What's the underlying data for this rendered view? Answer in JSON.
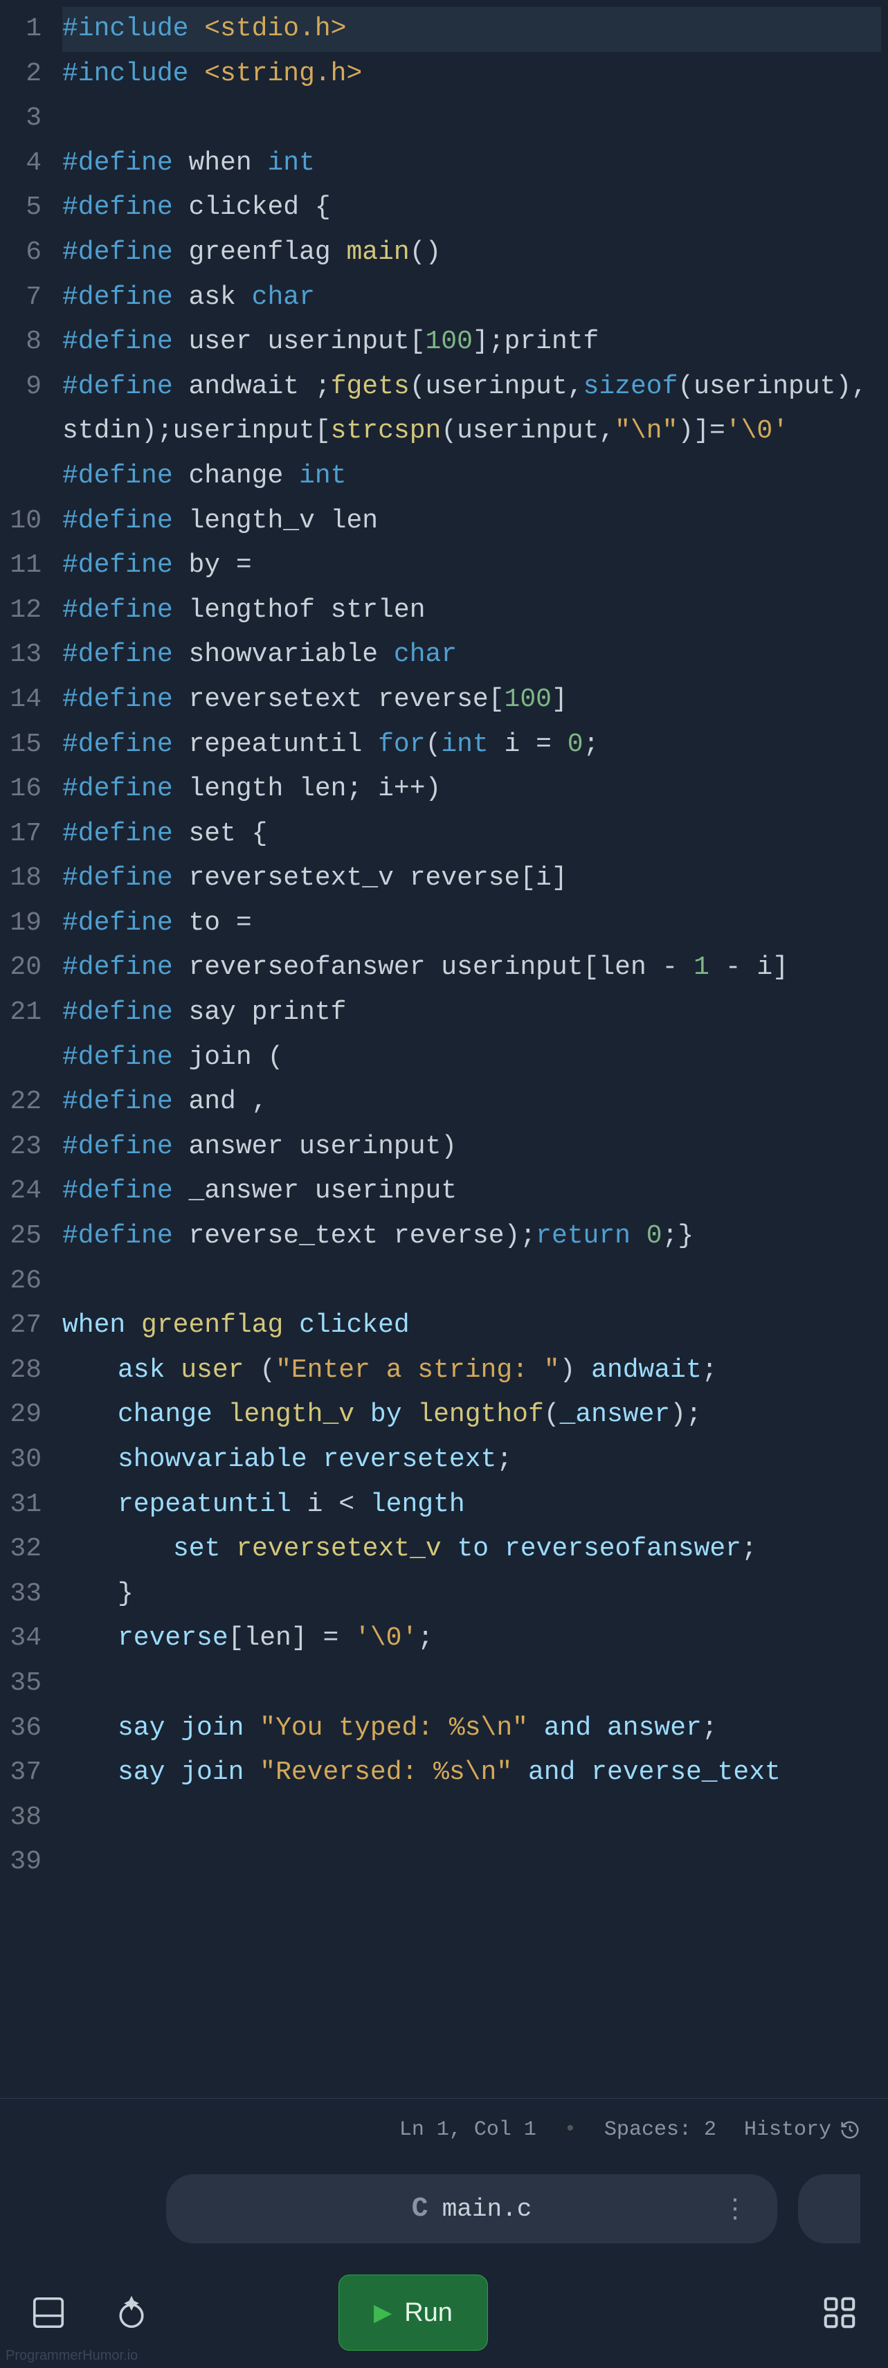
{
  "code": {
    "lines": [
      {
        "n": 1,
        "hl": true,
        "tokens": [
          {
            "c": "tok-pp",
            "t": "#include"
          },
          {
            "c": "tok-plain",
            "t": " "
          },
          {
            "c": "tok-str",
            "t": "<stdio.h>"
          }
        ]
      },
      {
        "n": 2,
        "tokens": [
          {
            "c": "tok-pp",
            "t": "#include"
          },
          {
            "c": "tok-plain",
            "t": " "
          },
          {
            "c": "tok-str",
            "t": "<string.h>"
          }
        ]
      },
      {
        "n": 3,
        "tokens": []
      },
      {
        "n": 4,
        "tokens": [
          {
            "c": "tok-pp",
            "t": "#define"
          },
          {
            "c": "tok-plain",
            "t": " when "
          },
          {
            "c": "tok-pp",
            "t": "int"
          }
        ]
      },
      {
        "n": 5,
        "tokens": [
          {
            "c": "tok-pp",
            "t": "#define"
          },
          {
            "c": "tok-plain",
            "t": " clicked {"
          }
        ]
      },
      {
        "n": 6,
        "tokens": [
          {
            "c": "tok-pp",
            "t": "#define"
          },
          {
            "c": "tok-plain",
            "t": " greenflag "
          },
          {
            "c": "tok-fn",
            "t": "main"
          },
          {
            "c": "tok-plain",
            "t": "()"
          }
        ]
      },
      {
        "n": 7,
        "tokens": [
          {
            "c": "tok-pp",
            "t": "#define"
          },
          {
            "c": "tok-plain",
            "t": " ask "
          },
          {
            "c": "tok-pp",
            "t": "char"
          }
        ]
      },
      {
        "n": 8,
        "tokens": [
          {
            "c": "tok-pp",
            "t": "#define"
          },
          {
            "c": "tok-plain",
            "t": " user userinput["
          },
          {
            "c": "tok-num",
            "t": "100"
          },
          {
            "c": "tok-plain",
            "t": "];printf"
          }
        ]
      },
      {
        "n": 9,
        "wrap": true,
        "tokens": [
          {
            "c": "tok-pp",
            "t": "#define"
          },
          {
            "c": "tok-plain",
            "t": " andwait ;"
          },
          {
            "c": "tok-fn",
            "t": "fgets"
          },
          {
            "c": "tok-plain",
            "t": "(userinput,"
          },
          {
            "c": "tok-pp",
            "t": "sizeof"
          },
          {
            "c": "tok-plain",
            "t": "(userinput),stdin);userinput["
          },
          {
            "c": "tok-fn",
            "t": "strcspn"
          },
          {
            "c": "tok-plain",
            "t": "(userinput,"
          },
          {
            "c": "tok-str",
            "t": "\"\\n\""
          },
          {
            "c": "tok-plain",
            "t": ")]="
          },
          {
            "c": "tok-char",
            "t": "'\\0'"
          }
        ]
      },
      {
        "n": 10,
        "tokens": [
          {
            "c": "tok-pp",
            "t": "#define"
          },
          {
            "c": "tok-plain",
            "t": " change "
          },
          {
            "c": "tok-pp",
            "t": "int"
          }
        ]
      },
      {
        "n": 11,
        "tokens": [
          {
            "c": "tok-pp",
            "t": "#define"
          },
          {
            "c": "tok-plain",
            "t": " length_v len"
          }
        ]
      },
      {
        "n": 12,
        "tokens": [
          {
            "c": "tok-pp",
            "t": "#define"
          },
          {
            "c": "tok-plain",
            "t": " by ="
          }
        ]
      },
      {
        "n": 13,
        "tokens": [
          {
            "c": "tok-pp",
            "t": "#define"
          },
          {
            "c": "tok-plain",
            "t": " lengthof strlen"
          }
        ]
      },
      {
        "n": 14,
        "tokens": [
          {
            "c": "tok-pp",
            "t": "#define"
          },
          {
            "c": "tok-plain",
            "t": " showvariable "
          },
          {
            "c": "tok-pp",
            "t": "char"
          }
        ]
      },
      {
        "n": 15,
        "tokens": [
          {
            "c": "tok-pp",
            "t": "#define"
          },
          {
            "c": "tok-plain",
            "t": " reversetext reverse["
          },
          {
            "c": "tok-num",
            "t": "100"
          },
          {
            "c": "tok-plain",
            "t": "]"
          }
        ]
      },
      {
        "n": 16,
        "tokens": [
          {
            "c": "tok-pp",
            "t": "#define"
          },
          {
            "c": "tok-plain",
            "t": " repeatuntil "
          },
          {
            "c": "tok-pp",
            "t": "for"
          },
          {
            "c": "tok-plain",
            "t": "("
          },
          {
            "c": "tok-pp",
            "t": "int"
          },
          {
            "c": "tok-plain",
            "t": " i = "
          },
          {
            "c": "tok-num",
            "t": "0"
          },
          {
            "c": "tok-plain",
            "t": ";"
          }
        ]
      },
      {
        "n": 17,
        "tokens": [
          {
            "c": "tok-pp",
            "t": "#define"
          },
          {
            "c": "tok-plain",
            "t": " length len; i++)"
          }
        ]
      },
      {
        "n": 18,
        "tokens": [
          {
            "c": "tok-pp",
            "t": "#define"
          },
          {
            "c": "tok-plain",
            "t": " set {"
          }
        ]
      },
      {
        "n": 19,
        "tokens": [
          {
            "c": "tok-pp",
            "t": "#define"
          },
          {
            "c": "tok-plain",
            "t": " reversetext_v reverse[i]"
          }
        ]
      },
      {
        "n": 20,
        "tokens": [
          {
            "c": "tok-pp",
            "t": "#define"
          },
          {
            "c": "tok-plain",
            "t": " to ="
          }
        ]
      },
      {
        "n": 21,
        "wrap": true,
        "tokens": [
          {
            "c": "tok-pp",
            "t": "#define"
          },
          {
            "c": "tok-plain",
            "t": " reverseofanswer userinput[len - "
          },
          {
            "c": "tok-num",
            "t": "1"
          },
          {
            "c": "tok-plain",
            "t": " - i]"
          }
        ]
      },
      {
        "n": 22,
        "tokens": [
          {
            "c": "tok-pp",
            "t": "#define"
          },
          {
            "c": "tok-plain",
            "t": " say printf"
          }
        ]
      },
      {
        "n": 23,
        "tokens": [
          {
            "c": "tok-pp",
            "t": "#define"
          },
          {
            "c": "tok-plain",
            "t": " join ("
          }
        ]
      },
      {
        "n": 24,
        "tokens": [
          {
            "c": "tok-pp",
            "t": "#define"
          },
          {
            "c": "tok-plain",
            "t": " and ,"
          }
        ]
      },
      {
        "n": 25,
        "tokens": [
          {
            "c": "tok-pp",
            "t": "#define"
          },
          {
            "c": "tok-plain",
            "t": " answer userinput)"
          }
        ]
      },
      {
        "n": 26,
        "tokens": [
          {
            "c": "tok-pp",
            "t": "#define"
          },
          {
            "c": "tok-plain",
            "t": " _answer userinput"
          }
        ]
      },
      {
        "n": 27,
        "tokens": [
          {
            "c": "tok-pp",
            "t": "#define"
          },
          {
            "c": "tok-plain",
            "t": " reverse_text reverse);"
          },
          {
            "c": "tok-pp",
            "t": "return"
          },
          {
            "c": "tok-plain",
            "t": " "
          },
          {
            "c": "tok-num",
            "t": "0"
          },
          {
            "c": "tok-plain",
            "t": ";}"
          }
        ]
      },
      {
        "n": 28,
        "tokens": []
      },
      {
        "n": 29,
        "tokens": [
          {
            "c": "tok-id",
            "t": "when"
          },
          {
            "c": "tok-plain",
            "t": " "
          },
          {
            "c": "tok-fn",
            "t": "greenflag"
          },
          {
            "c": "tok-plain",
            "t": " "
          },
          {
            "c": "tok-id",
            "t": "clicked"
          }
        ]
      },
      {
        "n": 30,
        "indent": 1,
        "tokens": [
          {
            "c": "tok-id",
            "t": "ask"
          },
          {
            "c": "tok-plain",
            "t": " "
          },
          {
            "c": "tok-fn",
            "t": "user"
          },
          {
            "c": "tok-plain",
            "t": " ("
          },
          {
            "c": "tok-str",
            "t": "\"Enter a string: \""
          },
          {
            "c": "tok-plain",
            "t": ") "
          },
          {
            "c": "tok-id",
            "t": "andwait"
          },
          {
            "c": "tok-plain",
            "t": ";"
          }
        ]
      },
      {
        "n": 31,
        "indent": 1,
        "tokens": [
          {
            "c": "tok-id",
            "t": "change"
          },
          {
            "c": "tok-plain",
            "t": " "
          },
          {
            "c": "tok-fn",
            "t": "length_v"
          },
          {
            "c": "tok-plain",
            "t": " "
          },
          {
            "c": "tok-id",
            "t": "by"
          },
          {
            "c": "tok-plain",
            "t": " "
          },
          {
            "c": "tok-fn",
            "t": "lengthof"
          },
          {
            "c": "tok-plain",
            "t": "("
          },
          {
            "c": "tok-id",
            "t": "_answer"
          },
          {
            "c": "tok-plain",
            "t": ");"
          }
        ]
      },
      {
        "n": 32,
        "indent": 1,
        "tokens": [
          {
            "c": "tok-id",
            "t": "showvariable"
          },
          {
            "c": "tok-plain",
            "t": " "
          },
          {
            "c": "tok-id",
            "t": "reversetext"
          },
          {
            "c": "tok-plain",
            "t": ";"
          }
        ]
      },
      {
        "n": 33,
        "indent": 1,
        "tokens": [
          {
            "c": "tok-id",
            "t": "repeatuntil"
          },
          {
            "c": "tok-plain",
            "t": " i < "
          },
          {
            "c": "tok-id",
            "t": "length"
          }
        ]
      },
      {
        "n": 34,
        "indent": 2,
        "tokens": [
          {
            "c": "tok-id",
            "t": "set"
          },
          {
            "c": "tok-plain",
            "t": " "
          },
          {
            "c": "tok-fn",
            "t": "reversetext_v"
          },
          {
            "c": "tok-plain",
            "t": " "
          },
          {
            "c": "tok-id",
            "t": "to"
          },
          {
            "c": "tok-plain",
            "t": " "
          },
          {
            "c": "tok-id",
            "t": "reverseofanswer"
          },
          {
            "c": "tok-plain",
            "t": ";"
          }
        ]
      },
      {
        "n": 35,
        "indent": 1,
        "tokens": [
          {
            "c": "tok-plain",
            "t": "}"
          }
        ]
      },
      {
        "n": 36,
        "indent": 1,
        "tokens": [
          {
            "c": "tok-id",
            "t": "reverse"
          },
          {
            "c": "tok-plain",
            "t": "[len] = "
          },
          {
            "c": "tok-char",
            "t": "'\\0'"
          },
          {
            "c": "tok-plain",
            "t": ";"
          }
        ]
      },
      {
        "n": 37,
        "tokens": []
      },
      {
        "n": 38,
        "indent": 1,
        "tokens": [
          {
            "c": "tok-id",
            "t": "say"
          },
          {
            "c": "tok-plain",
            "t": " "
          },
          {
            "c": "tok-id",
            "t": "join"
          },
          {
            "c": "tok-plain",
            "t": " "
          },
          {
            "c": "tok-str",
            "t": "\"You typed: %s\\n\""
          },
          {
            "c": "tok-plain",
            "t": " "
          },
          {
            "c": "tok-id",
            "t": "and"
          },
          {
            "c": "tok-plain",
            "t": " "
          },
          {
            "c": "tok-id",
            "t": "answer"
          },
          {
            "c": "tok-plain",
            "t": ";"
          }
        ]
      },
      {
        "n": 39,
        "wrap": true,
        "indent": 1,
        "tokens": [
          {
            "c": "tok-id",
            "t": "say"
          },
          {
            "c": "tok-plain",
            "t": " "
          },
          {
            "c": "tok-id",
            "t": "join"
          },
          {
            "c": "tok-plain",
            "t": " "
          },
          {
            "c": "tok-str",
            "t": "\"Reversed: %s\\n\""
          },
          {
            "c": "tok-plain",
            "t": " "
          },
          {
            "c": "tok-id",
            "t": "and"
          },
          {
            "c": "tok-plain",
            "t": " "
          },
          {
            "c": "tok-id",
            "t": "reverse_text"
          }
        ]
      }
    ]
  },
  "status": {
    "cursor": "Ln 1, Col 1",
    "spaces": "Spaces: 2",
    "history": "History"
  },
  "tab": {
    "icon_letter": "C",
    "filename": "main.c"
  },
  "run": {
    "label": "Run"
  },
  "watermark": "ProgrammerHumor.io"
}
